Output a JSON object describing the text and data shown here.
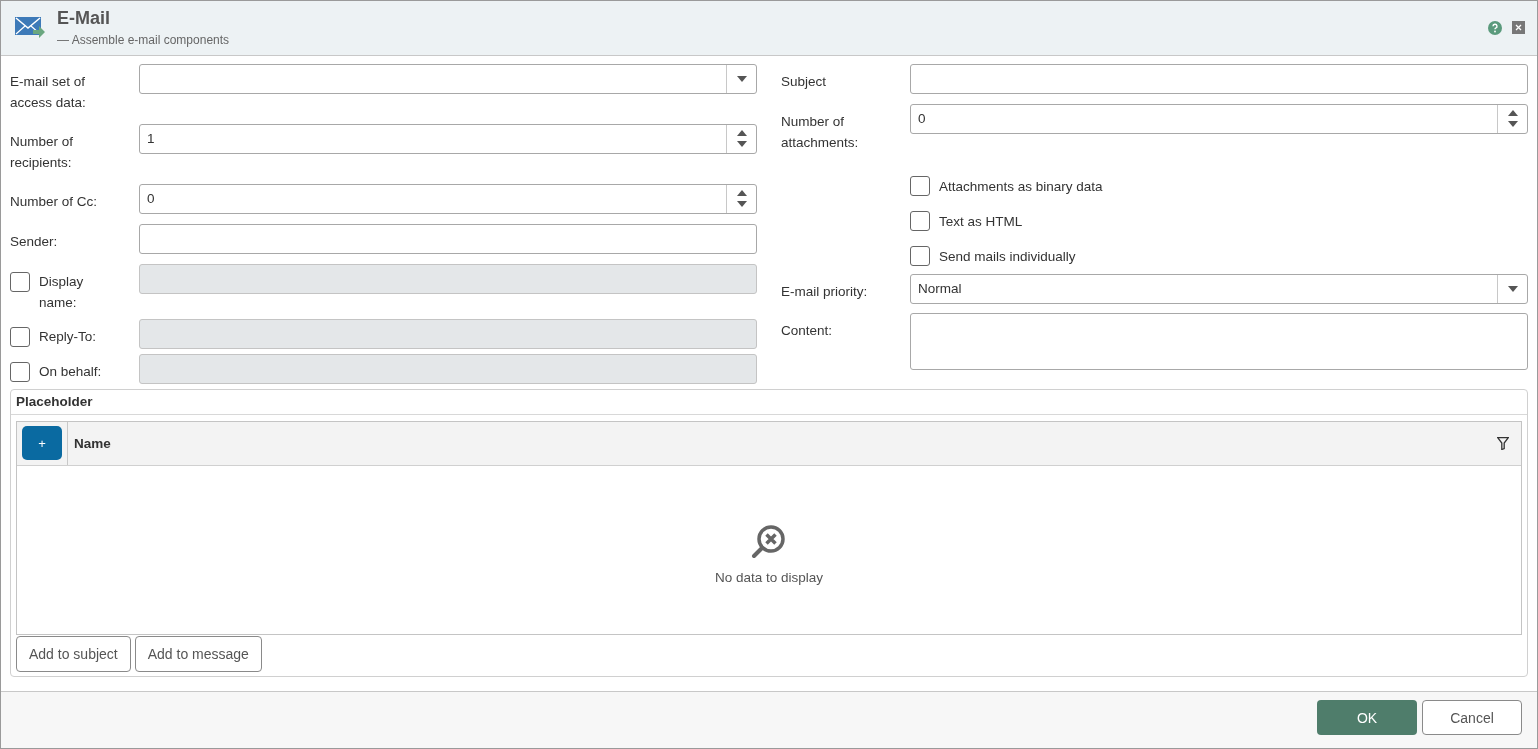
{
  "window": {
    "title": "E-Mail",
    "subtitle": "— Assemble e-mail components"
  },
  "left_fields": [
    {
      "kind": "dropdown",
      "label": "E-mail set of access data:"
    },
    {
      "kind": "spinner",
      "label": "Number of recipients:",
      "value": "1"
    },
    {
      "kind": "spinner",
      "label": "Number of Cc:",
      "value": "0"
    },
    {
      "kind": "text",
      "label": "Sender:"
    },
    {
      "kind": "optional",
      "label": "Display name:",
      "checked": false,
      "disabled": true
    },
    {
      "kind": "optional",
      "label": "Reply-To:",
      "checked": false,
      "disabled": true
    },
    {
      "kind": "optional",
      "label": "On behalf:",
      "checked": false,
      "disabled": true
    }
  ],
  "right_fields": [
    {
      "kind": "text",
      "label": "Subject"
    },
    {
      "kind": "spinner",
      "label": "Number of attachments:",
      "value": "0"
    },
    {
      "kind": "checkbox",
      "label": "Attachments as binary data",
      "checked": false
    },
    {
      "kind": "checkbox",
      "label": "Text as HTML",
      "checked": false
    },
    {
      "kind": "checkbox",
      "label": "Send mails individually",
      "checked": false
    },
    {
      "kind": "dropdown",
      "label": "E-mail priority:",
      "value": "Normal"
    },
    {
      "kind": "textarea",
      "label": "Content:"
    }
  ],
  "placeholder_panel": {
    "title": "Placeholder",
    "add_button": "+",
    "columns": [
      "Name"
    ],
    "empty_text": "No data to display",
    "buttons": [
      "Add to subject",
      "Add to message"
    ]
  },
  "footer": {
    "ok": "OK",
    "cancel": "Cancel"
  }
}
